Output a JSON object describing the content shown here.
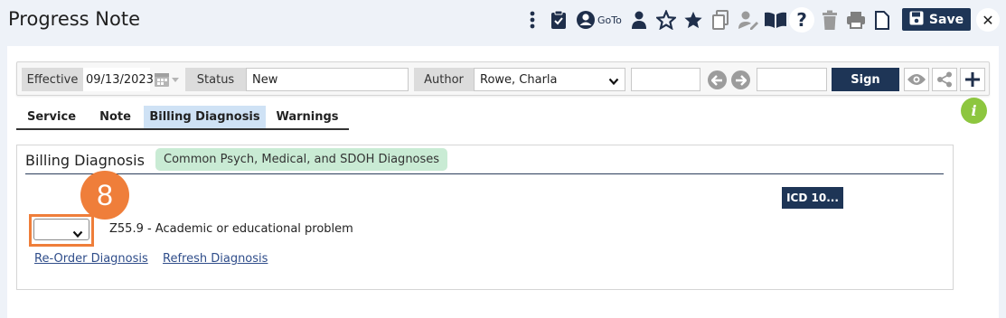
{
  "header": {
    "title": "Progress Note",
    "goto_label": "GoTo",
    "save_label": "Save",
    "close_label": "✕"
  },
  "fields": {
    "effective_label": "Effective",
    "effective_value": "09/13/2023",
    "status_label": "Status",
    "status_value": "New",
    "author_label": "Author",
    "author_value": "Rowe, Charla",
    "sign_label": "Sign"
  },
  "tabs": [
    {
      "label": "Service"
    },
    {
      "label": "Note"
    },
    {
      "label": "Billing Diagnosis",
      "active": true
    },
    {
      "label": "Warnings"
    }
  ],
  "billing": {
    "title": "Billing Diagnosis",
    "chip_label": "Common Psych, Medical, and SDOH Diagnoses",
    "icd_button": "ICD 10...",
    "step_number": "8",
    "diagnosis_text": "Z55.9 - Academic or educational problem",
    "order_value": "",
    "reorder_link": "Re-Order Diagnosis ",
    "refresh_link": "Refresh Diagnosis"
  },
  "info_icon_glyph": "i",
  "colors": {
    "navy": "#1e3556",
    "accent_orange": "#ef7e3a",
    "chip_green": "#c9ebd4",
    "info_green": "#8dc63f",
    "active_tab": "#cfe2f5"
  }
}
